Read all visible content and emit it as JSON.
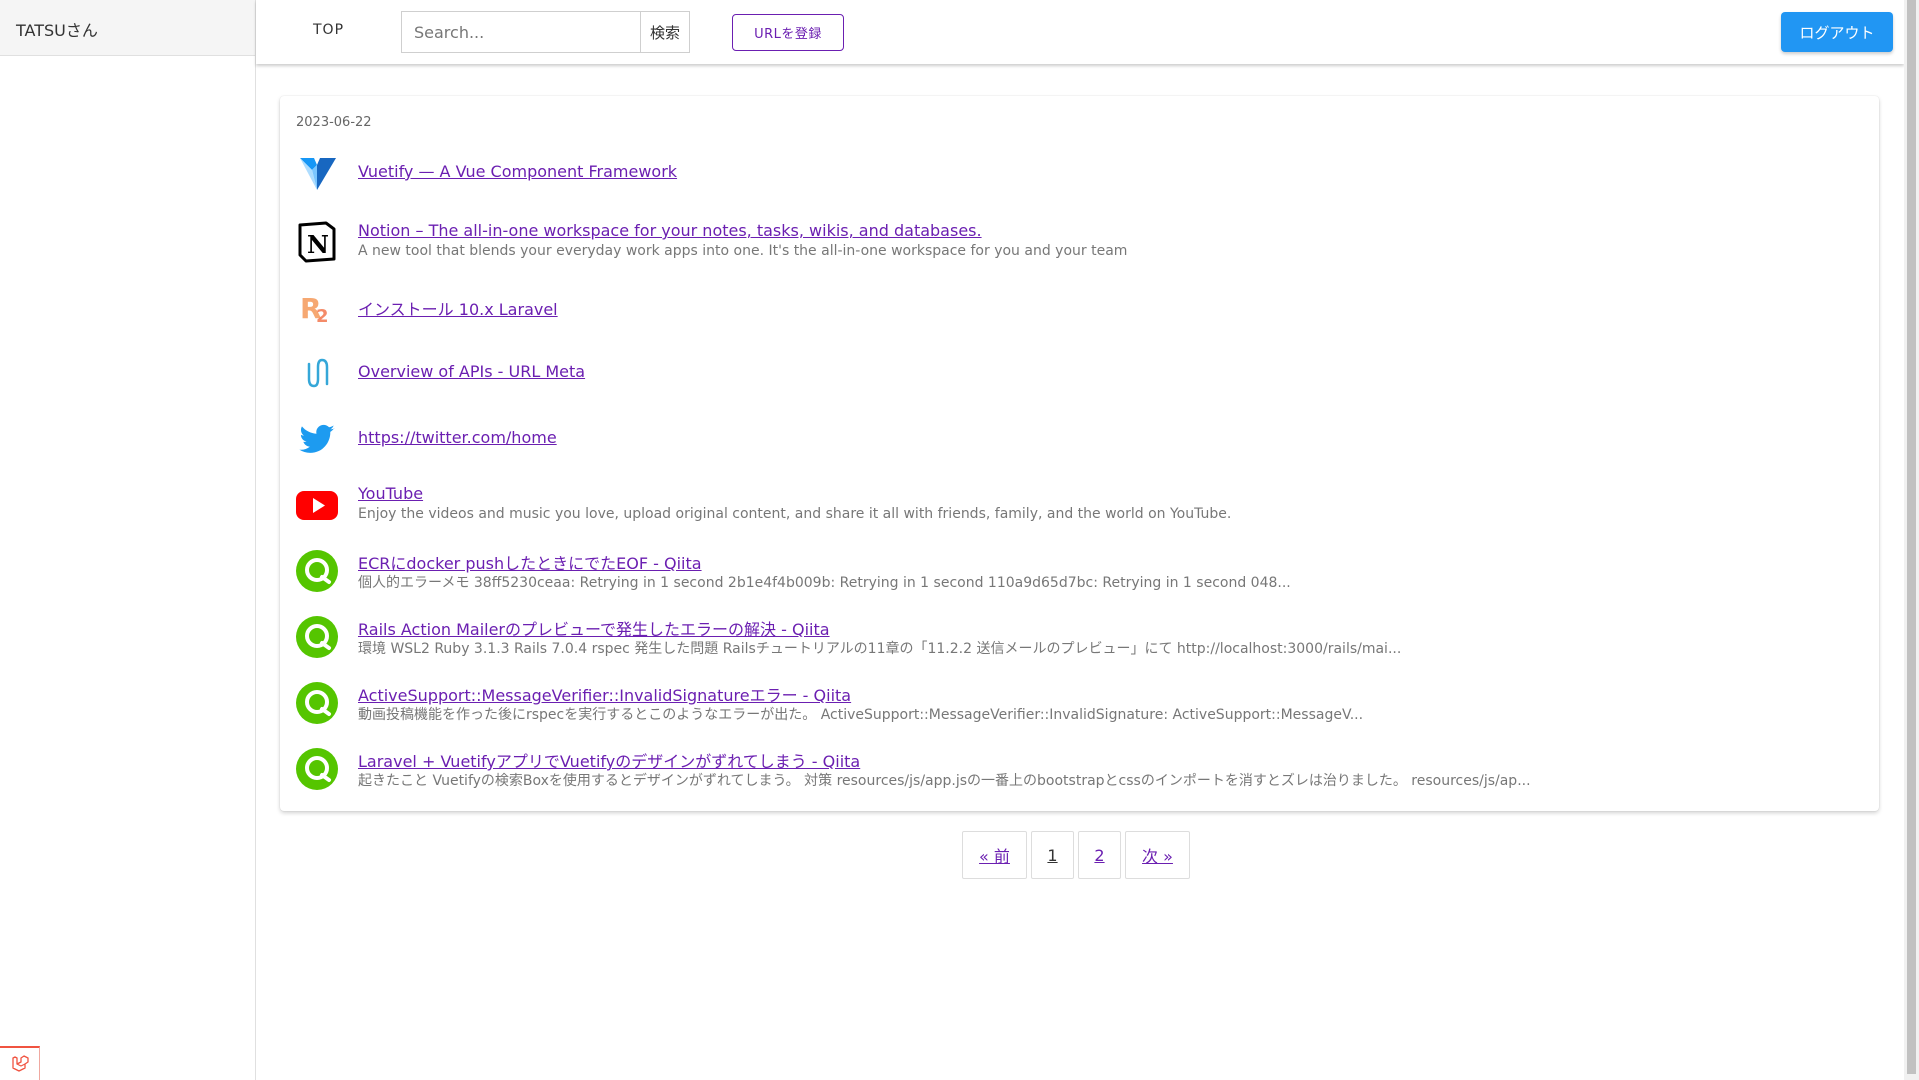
{
  "sidebar": {
    "user_name": "TATSUさん"
  },
  "header": {
    "nav_top": "TOP",
    "search_placeholder": "Search...",
    "search_button": "検索",
    "register_button": "URLを登録",
    "logout_button": "ログアウト"
  },
  "main": {
    "date": "2023-06-22",
    "items": [
      {
        "icon": "vuetify-icon",
        "title": "Vuetify — A Vue Component Framework",
        "description": ""
      },
      {
        "icon": "notion-icon",
        "title": "Notion – The all-in-one workspace for your notes, tasks, wikis, and databases.",
        "description": "A new tool that blends your everyday work apps into one. It's the all-in-one workspace for you and your team"
      },
      {
        "icon": "readouble-icon",
        "title": "インストール 10.x Laravel",
        "description": ""
      },
      {
        "icon": "urlmeta-icon",
        "title": "Overview of APIs - URL Meta",
        "description": ""
      },
      {
        "icon": "twitter-icon",
        "title": "https://twitter.com/home",
        "description": ""
      },
      {
        "icon": "youtube-icon",
        "title": "YouTube",
        "description": "Enjoy the videos and music you love, upload original content, and share it all with friends, family, and the world on YouTube."
      },
      {
        "icon": "qiita-icon",
        "title": "ECRにdocker pushしたときにでたEOF - Qiita",
        "description": "個人的エラーメモ 38ff5230ceaa: Retrying in 1 second 2b1e4f4b009b: Retrying in 1 second 110a9d65d7bc: Retrying in 1 second 048..."
      },
      {
        "icon": "qiita-icon",
        "title": "Rails Action Mailerのプレビューで発生したエラーの解決 - Qiita",
        "description": "環境 WSL2 Ruby 3.1.3 Rails 7.0.4 rspec 発生した問題 Railsチュートリアルの11章の「11.2.2 送信メールのプレビュー」にて http://localhost:3000/rails/mai..."
      },
      {
        "icon": "qiita-icon",
        "title": "ActiveSupport::MessageVerifier::InvalidSignatureエラー - Qiita",
        "description": "動画投稿機能を作った後にrspecを実行するとこのようなエラーが出た。 ActiveSupport::MessageVerifier::InvalidSignature: ActiveSupport::MessageV..."
      },
      {
        "icon": "qiita-icon",
        "title": "Laravel + VuetifyアプリでVuetifyのデザインがずれてしまう - Qiita",
        "description": "起きたこと Vuetifyの検索Boxを使用するとデザインがずれてしまう。 対策 resources/js/app.jsの一番上のbootstrapとcssのインポートを消すとズレは治りました。 resources/js/ap..."
      }
    ]
  },
  "pagination": {
    "prev": "« 前",
    "pages": [
      "1",
      "2"
    ],
    "next": "次 »"
  },
  "colors": {
    "link": "#6b1fb1",
    "primary": "#2196f3",
    "qiita": "#55c500",
    "youtube": "#ff0000",
    "twitter": "#1d9bf0"
  }
}
